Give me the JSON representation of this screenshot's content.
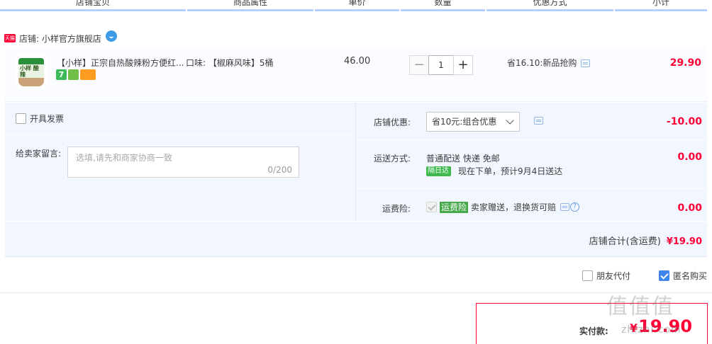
{
  "columns": [
    "店铺宝贝",
    "商品属性",
    "单价",
    "数量",
    "优惠方式",
    "小计"
  ],
  "shop": {
    "badge": "天猫",
    "name": "店铺: 小样官方旗舰店"
  },
  "item": {
    "thumb_text": "小样\n酸辣",
    "title": "【小样】正宗自热酸辣粉方便红...",
    "icon_seven": "7",
    "flavor": "口味: 【椒麻风味】5桶",
    "price": "46.00",
    "quantity": "1",
    "minus": "−",
    "plus": "+",
    "discount": "省16.10:新品抢购",
    "subtotal": "29.90"
  },
  "invoice": {
    "label": "开具发票"
  },
  "message": {
    "label": "给卖家留言:",
    "placeholder": "选填,请先和商家协商一致",
    "counter": "0/200"
  },
  "shop_discount": {
    "label": "店铺优惠:",
    "selected": "省10元:组合优惠",
    "amount": "-10.00"
  },
  "shipping": {
    "label": "运送方式:",
    "method": "普通配送 快递 免邮",
    "badge": "隔日达",
    "eta": "现在下单，预计9月4日送达",
    "amount": "0.00"
  },
  "insurance": {
    "label": "运费险:",
    "badge": "运费险",
    "text": "卖家赠送，退换货可赔",
    "help": "?",
    "amount": "0.00"
  },
  "shop_total": {
    "label": "店铺合计(含运费)",
    "amount": "¥19.90"
  },
  "options": {
    "friend_pay": "朋友代付",
    "anonymous": "匿名购买"
  },
  "payment": {
    "label": "实付款:",
    "currency": "¥",
    "amount": "19.90"
  },
  "watermark": {
    "text": "值值值",
    "sub": "zhizhi.com"
  },
  "colors": {
    "accent": "#ff0036",
    "header_line": "#b2d1ff",
    "panel_bg": "#f2f7ff",
    "check_blue": "#3e85ee",
    "green": "#45a94a"
  }
}
